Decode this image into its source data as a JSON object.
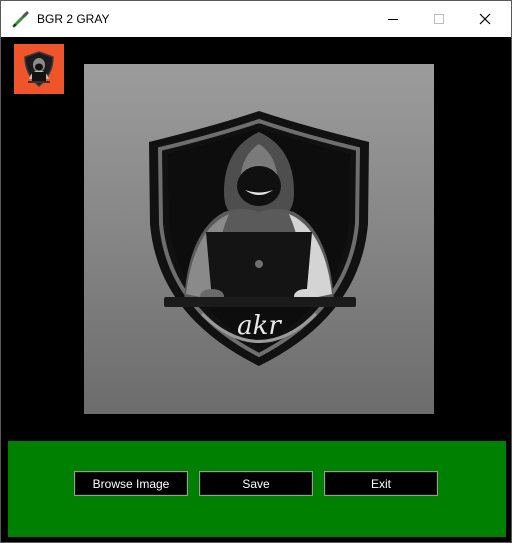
{
  "window": {
    "title": "BGR 2 GRAY",
    "icon": "pen-icon",
    "controls": [
      "minimize-icon",
      "maximize-icon",
      "close-icon"
    ]
  },
  "thumbnail": {
    "icon": "hacker-logo-thumbnail",
    "background": "#f0542a"
  },
  "preview": {
    "watermark_text": "akr"
  },
  "buttons": {
    "browse_label": "Browse Image",
    "save_label": "Save",
    "exit_label": "Exit"
  },
  "colors": {
    "panel": "#008000",
    "client_bg": "#000000",
    "button_bg": "#000000",
    "button_text": "#ffffff"
  }
}
